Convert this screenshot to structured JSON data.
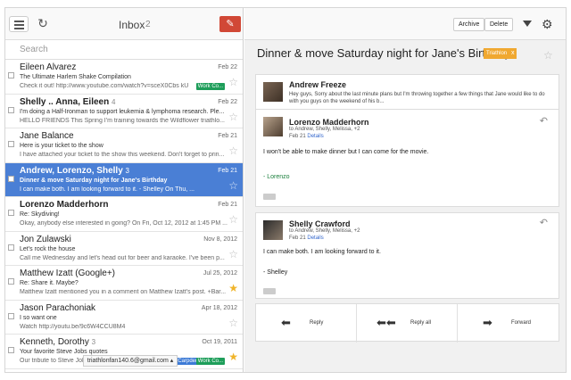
{
  "left": {
    "inbox_title": "Inbox",
    "inbox_count": "2",
    "search_placeholder": "Search",
    "account": "triathlonfan140.6@gmail.com ▴",
    "rows": [
      {
        "sender": "Eileen Alvarez",
        "count": "",
        "date": "Feb 22",
        "subject": "The Ultimate Harlem Shake Compilation",
        "snippet": "Check it out! http://www.youtube.com/watch?v=sceX0Cbs kU",
        "label": "Work Co...",
        "starred": false,
        "bold": false
      },
      {
        "sender": "Shelly .. Anna, Eileen",
        "count": "4",
        "date": "Feb 22",
        "subject": "I'm doing a Half-Ironman to support leukemia & lymphoma research. Ple...",
        "snippet": "HELLO FRIENDS This Spring I'm training towards the Wildflower triathlo...",
        "label": "",
        "starred": false,
        "bold": true
      },
      {
        "sender": "Jane Balance",
        "count": "",
        "date": "Feb 21",
        "subject": "Here is your ticket to the show",
        "snippet": "I have attached your ticket to the show this weekend. Don't forget to prin...",
        "label": "",
        "starred": false,
        "bold": false
      },
      {
        "sender": "Andrew, Lorenzo, Shelly",
        "count": "3",
        "date": "Feb 21",
        "subject": "Dinner & move Saturday night for Jane's Birthday",
        "snippet": "I can make both. I am looking forward to it. - Shelley On Thu, ...",
        "label": "",
        "starred": false,
        "bold": true
      },
      {
        "sender": "Lorenzo Madderhorn",
        "count": "",
        "date": "Feb 21",
        "subject": "Re: Skydiving!",
        "snippet": "Okay, anybody else interested in going? On Fri, Oct 12, 2012 at 1:45 PM ...",
        "label": "",
        "starred": false,
        "bold": true
      },
      {
        "sender": "Jon Zulawski",
        "count": "",
        "date": "Nov 8, 2012",
        "subject": "Let's rock the house",
        "snippet": "Call me Wednesday and let's head out for beer and karaoke. I've been p...",
        "label": "",
        "starred": false,
        "bold": false
      },
      {
        "sender": "Matthew Izatt (Google+)",
        "count": "",
        "date": "Jul 25, 2012",
        "subject": "Re: Share it. Maybe?",
        "snippet": "Matthew Izatt mentioned you in a comment on Matthew Izatt's post. +Bar...",
        "label": "",
        "starred": true,
        "bold": false
      },
      {
        "sender": "Jason Parachoniak",
        "count": "",
        "date": "Apr 18, 2012",
        "subject": "I so want one",
        "snippet": "Watch http://youtu.be/9c6W4CCU8M4",
        "label": "",
        "starred": false,
        "bold": false
      },
      {
        "sender": "Kenneth, Dorothy",
        "count": "3",
        "date": "Oct 19, 2011",
        "subject": "Your favorite Steve Jobs quotes",
        "snippet": "Our tribute to Steve Jobs, we've been collectin...",
        "label": "Carpdem",
        "label2": "Work Co...",
        "starred": true,
        "bold": false
      }
    ]
  },
  "right": {
    "archive": "Archive",
    "delete": "Delete",
    "subject": "Dinner & move Saturday night for Jane's Birthday",
    "tag": "Triathlon",
    "tag_x": "x",
    "msg1": {
      "name": "Andrew Freeze",
      "preview": "Hey guys, Sorry about the last minute plans but I'm throwing together a few things that Jane would like to do with you guys on the weekend of his b..."
    },
    "msg2": {
      "name": "Lorenzo Madderhorn",
      "date": "Feb 21",
      "to": "to Andrew, Shelly, Melissa, +2",
      "details": "Details",
      "body": "I won't be able to make dinner but I can come for the movie.",
      "sig": "- Lorenzo"
    },
    "msg3": {
      "name": "Shelly Crawford",
      "date": "Feb 21",
      "to": "to Andrew, Shelly, Melissa, +2",
      "details": "Details",
      "body": "I can make both. I am looking forward to it.",
      "sig": "- Shelley"
    },
    "actions": {
      "reply": "Reply",
      "reply_all": "Reply all",
      "forward": "Forward"
    }
  }
}
